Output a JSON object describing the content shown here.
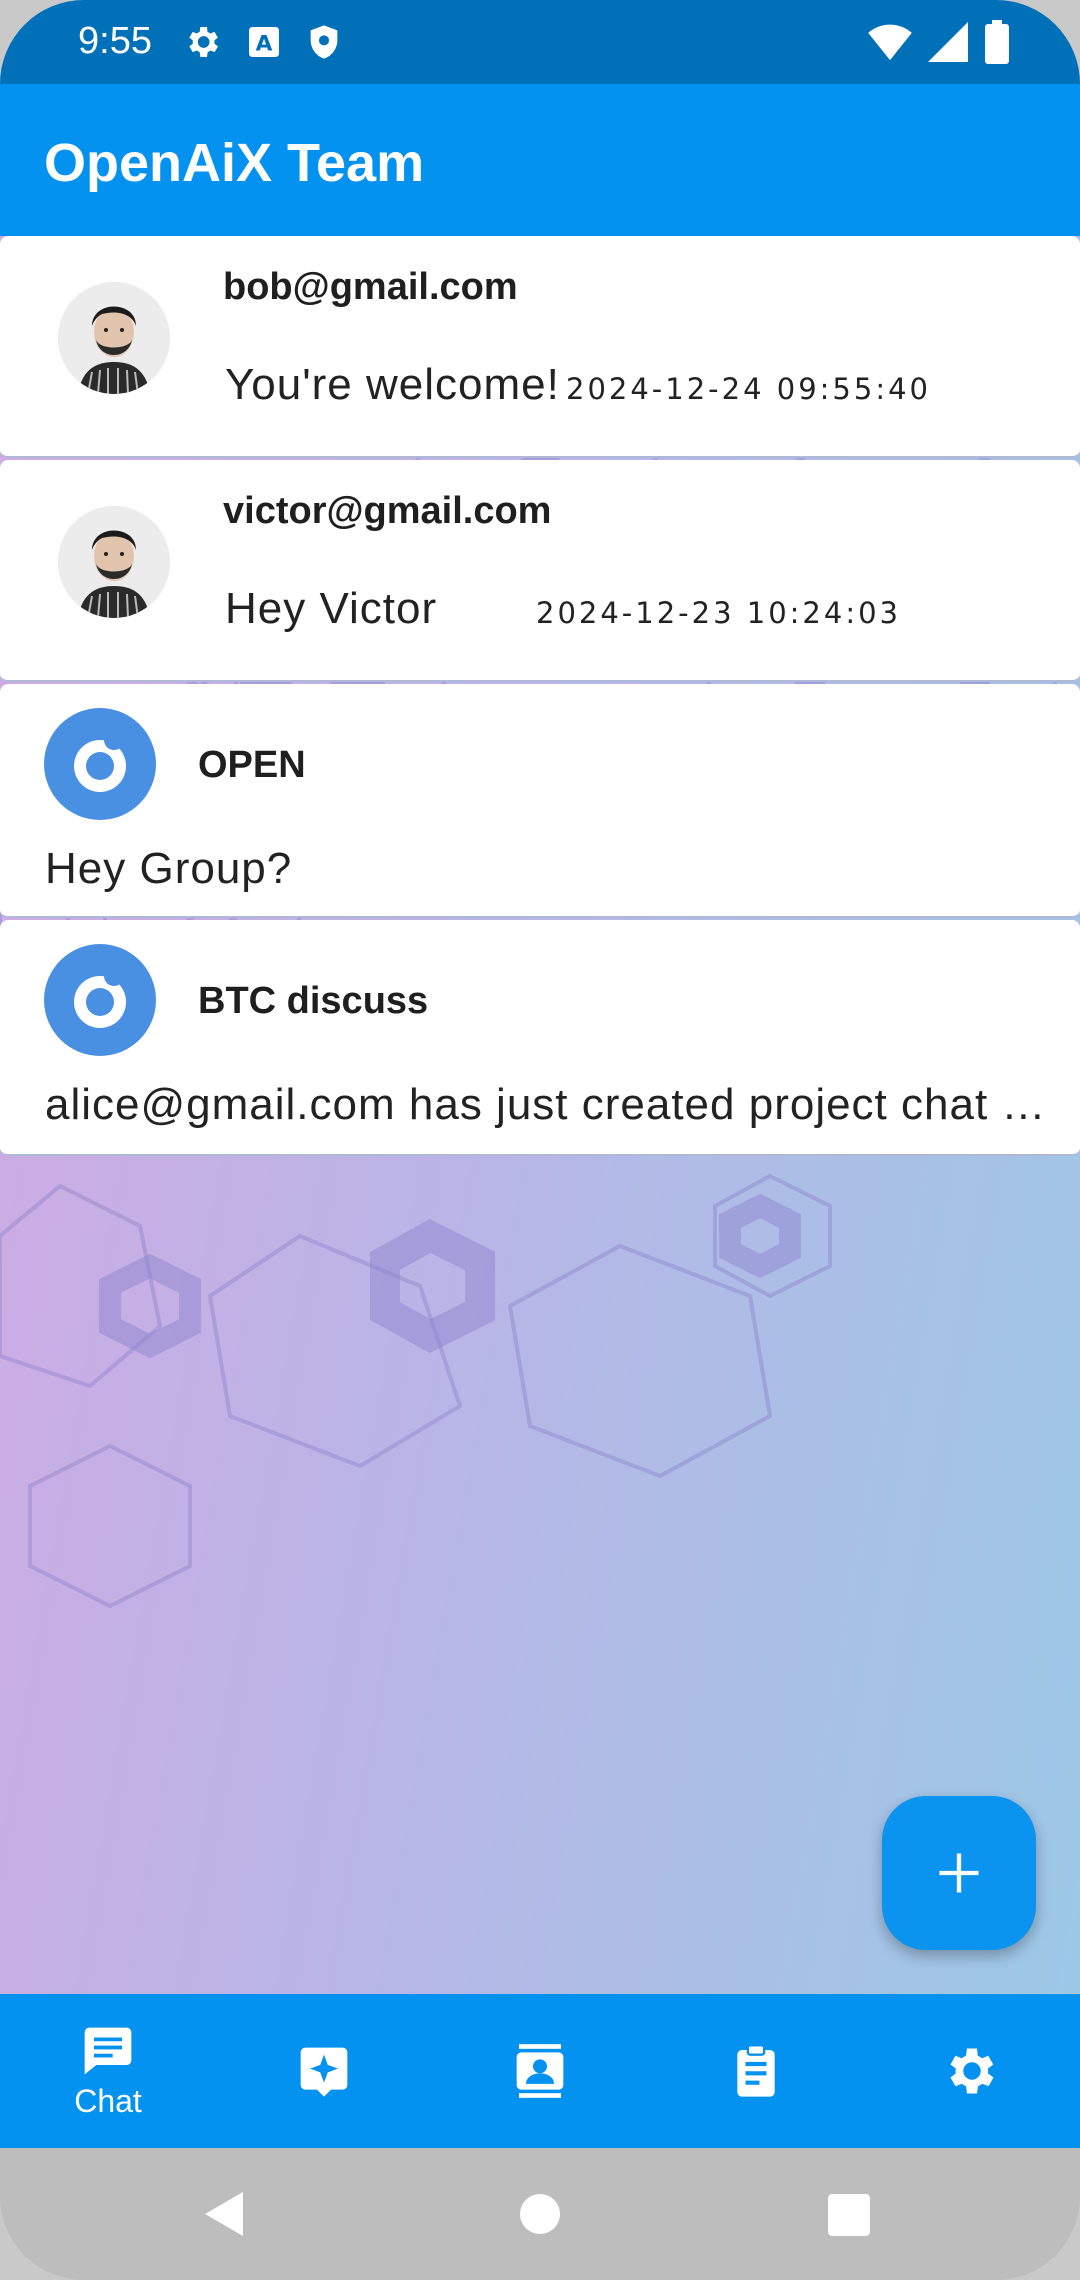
{
  "status_bar": {
    "time": "9:55",
    "icons": [
      "gear-icon",
      "a-badge-icon",
      "shield-icon",
      "wifi-icon",
      "signal-icon",
      "battery-icon"
    ]
  },
  "app_bar": {
    "title": "OpenAiX Team"
  },
  "chats": [
    {
      "name": "bob@gmail.com",
      "message": "You're welcome!",
      "time": "2024-12-24 09:55:40",
      "type": "direct"
    },
    {
      "name": "victor@gmail.com",
      "message": "Hey Victor",
      "time": "2024-12-23 10:24:03",
      "type": "direct"
    },
    {
      "name": "OPEN",
      "message": "Hey Group?",
      "type": "group"
    },
    {
      "name": "BTC discuss",
      "message": "alice@gmail.com has just created project chat …",
      "type": "group"
    }
  ],
  "fab": {
    "icon": "plus-icon"
  },
  "bottom_nav": {
    "items": [
      {
        "label": "Chat",
        "icon": "chat-icon",
        "active": true
      },
      {
        "label": "",
        "icon": "ai-sparkle-icon"
      },
      {
        "label": "",
        "icon": "contacts-icon"
      },
      {
        "label": "",
        "icon": "clipboard-icon"
      },
      {
        "label": "",
        "icon": "settings-icon"
      }
    ]
  },
  "colors": {
    "status_bar": "#0070b8",
    "app_bar": "#0492f0",
    "accent": "#0a93ef",
    "group_logo": "#4a90e2"
  }
}
